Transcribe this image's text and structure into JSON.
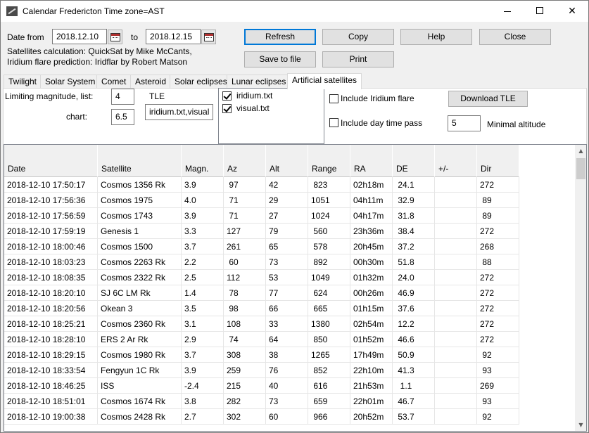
{
  "window": {
    "title": "Calendar Fredericton Time zone=AST",
    "controls": {
      "minimize": "minimize",
      "maximize": "maximize",
      "close": "✕"
    }
  },
  "top": {
    "date_from_label": "Date from",
    "date_from": "2018.12.10",
    "to_label": "to",
    "date_to": "2018.12.15",
    "credit_line1": "Satellites calculation: QuickSat by Mike McCants,",
    "credit_line2": "Iridium flare prediction: Iridflar by Robert Matson",
    "buttons": {
      "refresh": "Refresh",
      "copy": "Copy",
      "help": "Help",
      "close": "Close",
      "save": "Save to file",
      "print": "Print"
    }
  },
  "tabs": [
    {
      "label": "Twilight"
    },
    {
      "label": "Solar System"
    },
    {
      "label": "Comet"
    },
    {
      "label": "Asteroid"
    },
    {
      "label": "Solar eclipses"
    },
    {
      "label": "Lunar eclipses"
    },
    {
      "label": "Artificial satellites",
      "active": true
    }
  ],
  "options": {
    "limiting_label": "Limiting magnitude, list:",
    "limiting_list": "4",
    "chart_label": "chart:",
    "limiting_chart": "6.5",
    "tle_label": "TLE",
    "tle_value": "iridium.txt,visual",
    "tle_files": [
      {
        "name": "iridium.txt",
        "checked": true
      },
      {
        "name": "visual.txt",
        "checked": true
      }
    ],
    "include_iridium": "Include Iridium flare",
    "include_iridium_checked": false,
    "include_daytime": "Include day time pass",
    "include_daytime_checked": false,
    "download_tle": "Download TLE",
    "min_altitude_value": "5",
    "min_altitude_label": "Minimal altitude"
  },
  "table": {
    "columns": [
      "Date",
      "Satellite",
      "Magn.",
      "Az",
      "Alt",
      "Range",
      "RA",
      "DE",
      "+/-",
      "Dir"
    ],
    "rows": [
      [
        "2018-12-10 17:50:17",
        "Cosmos 1356 Rk",
        "3.9",
        " 97",
        "42",
        " 823",
        "02h18m",
        " 24.1",
        "",
        "272"
      ],
      [
        "2018-12-10 17:56:36",
        "Cosmos 1975",
        "4.0",
        " 71",
        "29",
        "1051",
        "04h11m",
        " 32.9",
        "",
        " 89"
      ],
      [
        "2018-12-10 17:56:59",
        "Cosmos 1743",
        "3.9",
        " 71",
        "27",
        "1024",
        "04h17m",
        " 31.8",
        "",
        " 89"
      ],
      [
        "2018-12-10 17:59:19",
        "Genesis 1",
        "3.3",
        "127",
        "79",
        " 560",
        "23h36m",
        " 38.4",
        "",
        "272"
      ],
      [
        "2018-12-10 18:00:46",
        "Cosmos 1500",
        "3.7",
        "261",
        "65",
        " 578",
        "20h45m",
        " 37.2",
        "",
        "268"
      ],
      [
        "2018-12-10 18:03:23",
        "Cosmos 2263 Rk",
        "2.2",
        " 60",
        "73",
        " 892",
        "00h30m",
        " 51.8",
        "",
        " 88"
      ],
      [
        "2018-12-10 18:08:35",
        "Cosmos 2322 Rk",
        "2.5",
        "112",
        "53",
        "1049",
        "01h32m",
        " 24.0",
        "",
        "272"
      ],
      [
        "2018-12-10 18:20:10",
        "SJ 6C LM Rk",
        "1.4",
        " 78",
        "77",
        " 624",
        "00h26m",
        " 46.9",
        "",
        "272"
      ],
      [
        "2018-12-10 18:20:56",
        "Okean 3",
        "3.5",
        " 98",
        "66",
        " 665",
        "01h15m",
        " 37.6",
        "",
        "272"
      ],
      [
        "2018-12-10 18:25:21",
        "Cosmos 2360 Rk",
        "3.1",
        "108",
        "33",
        "1380",
        "02h54m",
        " 12.2",
        "",
        "272"
      ],
      [
        "2018-12-10 18:28:10",
        "ERS 2 Ar Rk",
        "2.9",
        " 74",
        "64",
        " 850",
        "01h52m",
        " 46.6",
        "",
        "272"
      ],
      [
        "2018-12-10 18:29:15",
        "Cosmos 1980 Rk",
        "3.7",
        "308",
        "38",
        "1265",
        "17h49m",
        " 50.9",
        "",
        " 92"
      ],
      [
        "2018-12-10 18:33:54",
        "Fengyun 1C Rk",
        "3.9",
        "259",
        "76",
        " 852",
        "22h10m",
        " 41.3",
        "",
        " 93"
      ],
      [
        "2018-12-10 18:46:25",
        "ISS",
        "-2.4",
        "215",
        "40",
        " 616",
        "21h53m",
        "  1.1",
        "",
        "269"
      ],
      [
        "2018-12-10 18:51:01",
        "Cosmos 1674 Rk",
        "3.8",
        "282",
        "73",
        " 659",
        "22h01m",
        " 46.7",
        "",
        " 93"
      ],
      [
        "2018-12-10 19:00:38",
        "Cosmos 2428 Rk",
        "2.7",
        "302",
        "60",
        " 966",
        "20h52m",
        " 53.7",
        "",
        " 92"
      ]
    ]
  }
}
